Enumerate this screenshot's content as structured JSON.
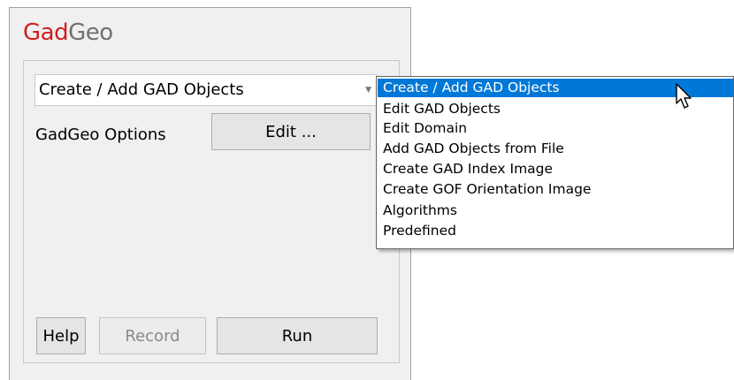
{
  "app": {
    "title_accent": "Gad",
    "title_rest": "Geo"
  },
  "combo": {
    "selected": "Create / Add GAD Objects",
    "arrow_icon": "chevron-down-icon"
  },
  "options": {
    "label": "GadGeo Options",
    "edit_button": "Edit ..."
  },
  "footer": {
    "help": "Help",
    "record": "Record",
    "run": "Run"
  },
  "dropdown": {
    "items": [
      "Create / Add GAD Objects",
      "Edit GAD Objects",
      "Edit Domain",
      "Add GAD Objects from File",
      "Create GAD Index Image",
      "Create GOF Orientation Image",
      "Algorithms",
      "Predefined"
    ]
  },
  "colors": {
    "accent": "#d01f1f",
    "selection": "#0078d7"
  }
}
